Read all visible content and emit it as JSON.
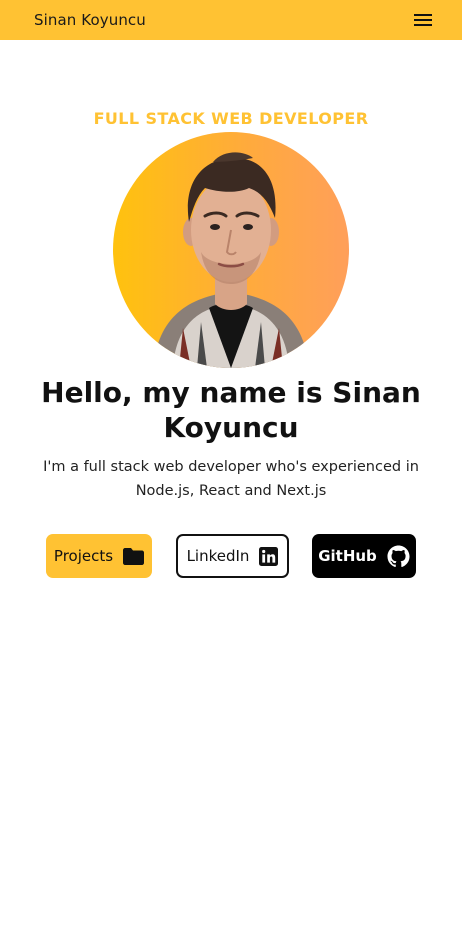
{
  "header": {
    "brand": "Sinan Koyuncu",
    "menu_icon": "hamburger-menu-icon"
  },
  "hero": {
    "role": "FULL STACK WEB DEVELOPER",
    "heading": "Hello, my name is Sinan Koyuncu",
    "subtitle": "I'm a full stack web developer who's experienced in Node.js, React and Next.js",
    "avatar_alt": "Profile photo"
  },
  "buttons": {
    "projects": {
      "label": "Projects",
      "icon": "folder-icon"
    },
    "linkedin": {
      "label": "LinkedIn",
      "icon": "linkedin-icon"
    },
    "github": {
      "label": "GitHub",
      "icon": "github-icon"
    }
  },
  "colors": {
    "accent": "#ffc233",
    "text": "#111111",
    "github_bg": "#000000"
  }
}
